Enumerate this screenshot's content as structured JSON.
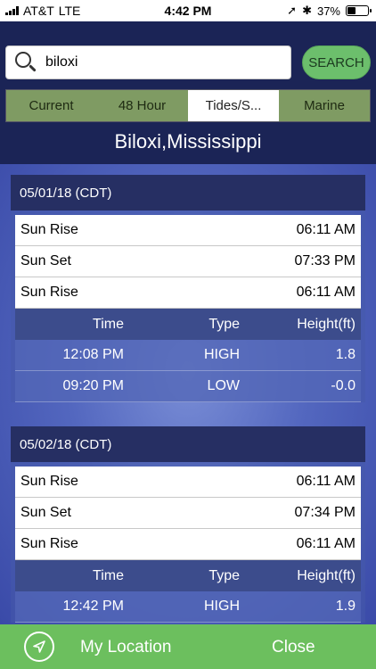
{
  "status": {
    "carrier": "AT&T",
    "network": "LTE",
    "time": "4:42 PM",
    "battery": "37%",
    "battery_level": 0.37
  },
  "search": {
    "value": "biloxi",
    "button_label": "SEARCH"
  },
  "tabs": [
    {
      "label": "Current"
    },
    {
      "label": "48 Hour"
    },
    {
      "label": "Tides/S..."
    },
    {
      "label": "Marine"
    }
  ],
  "city": "Biloxi,Mississippi",
  "days": [
    {
      "date": "05/01/18 (CDT)",
      "sun": [
        {
          "label": "Sun Rise",
          "time": "06:11 AM"
        },
        {
          "label": "Sun Set",
          "time": "07:33 PM"
        },
        {
          "label": "Sun Rise",
          "time": "06:11 AM"
        }
      ],
      "tide_headers": {
        "time": "Time",
        "type": "Type",
        "height": "Height(ft)"
      },
      "tides": [
        {
          "time": "12:08 PM",
          "type": "HIGH",
          "height": "1.8"
        },
        {
          "time": "09:20 PM",
          "type": "LOW",
          "height": "-0.0"
        }
      ]
    },
    {
      "date": "05/02/18 (CDT)",
      "sun": [
        {
          "label": "Sun Rise",
          "time": "06:11 AM"
        },
        {
          "label": "Sun Set",
          "time": "07:34 PM"
        },
        {
          "label": "Sun Rise",
          "time": "06:11 AM"
        }
      ],
      "tide_headers": {
        "time": "Time",
        "type": "Type",
        "height": "Height(ft)"
      },
      "tides": [
        {
          "time": "12:42 PM",
          "type": "HIGH",
          "height": "1.9"
        }
      ]
    }
  ],
  "bottom": {
    "location_label": "My Location",
    "close_label": "Close"
  },
  "colors": {
    "header_bg": "#1b2456",
    "accent_green": "#6cbf6c",
    "tab_green": "#7f9b63",
    "day_header": "#262f63"
  }
}
